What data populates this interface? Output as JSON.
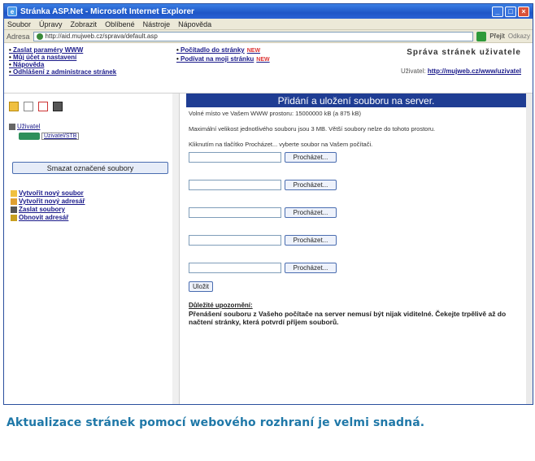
{
  "window": {
    "title": "Stránka ASP.Net - Microsoft Internet Explorer",
    "controls": [
      "_",
      "□",
      "×"
    ]
  },
  "menubar": [
    "Soubor",
    "Úpravy",
    "Zobrazit",
    "Oblíbené",
    "Nástroje",
    "Nápověda"
  ],
  "addressbar": {
    "label": "Adresa",
    "url": "http://aid.mujweb.cz/sprava/default.asp",
    "go_label": "Přejít",
    "links_label": "Odkazy"
  },
  "topnav": {
    "left_links": [
      "Zaslat paraméry WWW",
      "Můj účet a nastavení",
      "Nápověda",
      "Odhlášení z administrace stránek"
    ],
    "middle_links": [
      {
        "label": "Počítadlo do stránky",
        "badge": "NEW"
      },
      {
        "label": "Podívat na moji stránku",
        "badge": "NEW"
      }
    ],
    "admin_title": "Správa stránek uživatele",
    "user_label": "Uživatel:",
    "user_value": "http://mujweb.cz/www/uzivatel"
  },
  "sidebar": {
    "tree_root": "Uživatel",
    "tree_child": "Uzivatel/STB",
    "main_button": "Smazat označené soubory",
    "actions": [
      "Vytvořit nový soubor",
      "Vytvořit nový adresář",
      "Zaslat soubory",
      "Obnovit adresář"
    ]
  },
  "main": {
    "header": "Přidání a uložení souboru na server.",
    "space_info": "Volné místo ve Vašem WWW prostoru: 15000000 kB (a 875 kB)",
    "max_size_info": "Maximální velikost jednotlivého souboru jsou 3 MB. Větší soubory nelze do tohoto prostoru.",
    "instruction": "Kliknutím na tlačítko Procházet... vyberte soubor na Vašem počítači.",
    "browse_label": "Procházet...",
    "rows": 5,
    "save_label": "Uložit",
    "warning_title": "Důležité upozornění:",
    "warning_text": "Přenášení souboru z Vašeho počítače na server nemusí být nijak viditelné. Čekejte trpělivě až do načtení stránky, která potvrdí příjem souborů."
  },
  "caption": "Aktualizace stránek pomocí webového rozhraní je velmi snadná."
}
